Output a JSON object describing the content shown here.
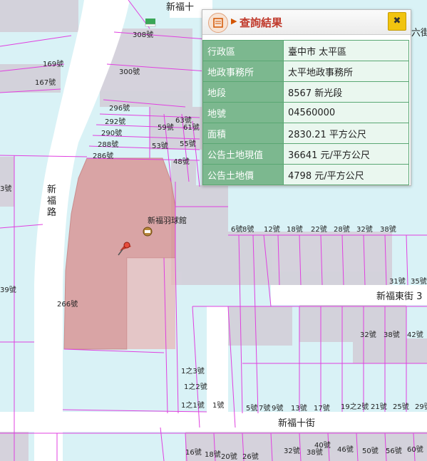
{
  "map": {
    "roads": {
      "xinfu_road": "新\n福\n路",
      "xinfu_10th_st": "新福十街",
      "xinfu_10th_st_top": "新福十",
      "xinfu_east_st": "新福東街 3",
      "liu_jie": "六街"
    },
    "poi": {
      "name": "新福羽球館"
    },
    "house_numbers": [
      "308號",
      "169號",
      "167號",
      "300號",
      "296號",
      "292號",
      "290號",
      "288號",
      "286號",
      "63號",
      "59號",
      "61號",
      "53號",
      "55號",
      "48號",
      "3號",
      "39號",
      "266號",
      "6號",
      "8號",
      "12號",
      "18號",
      "22號",
      "28號",
      "32號",
      "38號",
      "31號",
      "35號",
      "32號",
      "38號",
      "42號",
      "1之3號",
      "1之2號",
      "1之1號",
      "1號",
      "5號",
      "7號",
      "9號",
      "13號",
      "17號",
      "19之2號",
      "21號",
      "25號",
      "29號",
      "16號",
      "18號",
      "20號",
      "26號",
      "32號",
      "38號",
      "40號",
      "46號",
      "50號",
      "56號",
      "60號"
    ]
  },
  "panel": {
    "title": "查詢結果",
    "close_label": "✖",
    "rows": [
      {
        "key": "行政區",
        "value": "臺中市 太平區"
      },
      {
        "key": "地政事務所",
        "value": "太平地政事務所"
      },
      {
        "key": "地段",
        "value": "8567 新光段"
      },
      {
        "key": "地號",
        "value": "04560000"
      },
      {
        "key": "面積",
        "value": "2830.21 平方公尺"
      },
      {
        "key": "公告土地現值",
        "value": "36641 元/平方公尺"
      },
      {
        "key": "公告土地價",
        "value": "4798 元/平方公尺"
      }
    ]
  },
  "colors": {
    "parcel_line": "#e040e0",
    "highlight": "#d98a8a",
    "water_bg": "#d9f2f6",
    "building": "#d3cdd7",
    "table_key_bg": "#7cb88f",
    "title": "#c0392b"
  },
  "icons": {
    "marker": "pin-icon",
    "badminton": "badminton-icon",
    "close": "close-icon",
    "panel": "document-icon"
  }
}
